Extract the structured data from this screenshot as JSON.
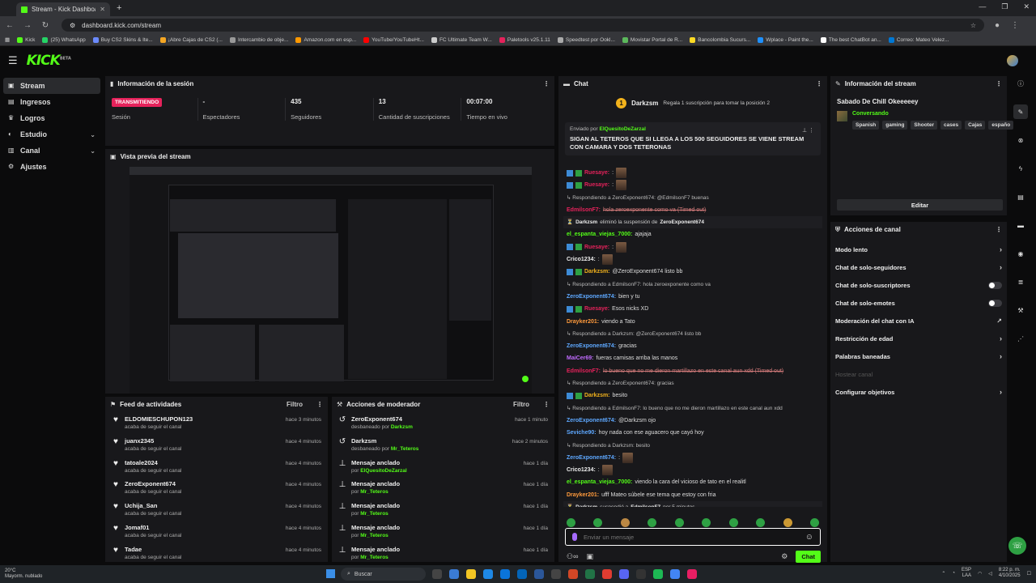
{
  "browser": {
    "tab_title": "Stream - Kick Dashboard",
    "url": "dashboard.kick.com/stream",
    "bookmarks": [
      "Kick",
      "(25) WhatsApp",
      "Buy CS2 Skins & Ite...",
      "¡Abre Cajas de CS2 (...",
      "Intercambio de obje...",
      "Amazon.com en esp...",
      "YouTube/YouTubeHt...",
      "FC Ultimate Team W...",
      "Paletools v25.1.11",
      "Speedtest por Ookl...",
      "Movistar Portal de R...",
      "Bancolombia Sucurs...",
      "Wplace - Paint the...",
      "The best ChatBot an...",
      "Correo: Mateo Velez..."
    ]
  },
  "sidebar": {
    "items": [
      {
        "label": "Stream",
        "icon": "stream-icon"
      },
      {
        "label": "Ingresos",
        "icon": "money-icon"
      },
      {
        "label": "Logros",
        "icon": "trophy-icon"
      },
      {
        "label": "Estudio",
        "icon": "studio-icon"
      },
      {
        "label": "Canal",
        "icon": "channel-icon"
      },
      {
        "label": "Ajustes",
        "icon": "gear-icon"
      }
    ]
  },
  "session": {
    "title": "Información de la sesión",
    "live_badge": "TRANSMITIENDO",
    "stats": [
      {
        "value": "",
        "label": "Sesión"
      },
      {
        "value": "-",
        "label": "Espectadores"
      },
      {
        "value": "435",
        "label": "Seguidores"
      },
      {
        "value": "13",
        "label": "Cantidad de suscripciones"
      },
      {
        "value": "00:07:00",
        "label": "Tiempo en vivo"
      }
    ]
  },
  "preview": {
    "title": "Vista previa del stream"
  },
  "activity": {
    "title": "Feed de actividades",
    "filter": "Filtro",
    "rows": [
      {
        "name": "ELDOMIESCHUPON123",
        "sub": "acaba de seguir el canal",
        "time": "hace 3 minutos"
      },
      {
        "name": "juanx2345",
        "sub": "acaba de seguir el canal",
        "time": "hace 4 minutos"
      },
      {
        "name": "tatoale2024",
        "sub": "acaba de seguir el canal",
        "time": "hace 4 minutos"
      },
      {
        "name": "ZeroExponent674",
        "sub": "acaba de seguir el canal",
        "time": "hace 4 minutos"
      },
      {
        "name": "Uchija_San",
        "sub": "acaba de seguir el canal",
        "time": "hace 4 minutos"
      },
      {
        "name": "Jomaf01",
        "sub": "acaba de seguir el canal",
        "time": "hace 4 minutos"
      },
      {
        "name": "Tadae",
        "sub": "acaba de seguir el canal",
        "time": "hace 4 minutos"
      }
    ]
  },
  "moderator": {
    "title": "Acciones de moderador",
    "filter": "Filtro",
    "rows": [
      {
        "name": "ZeroExponent674",
        "sub": "desbaneado por",
        "by": "Darkzsm",
        "time": "hace 1 minuto"
      },
      {
        "name": "Darkzsm",
        "sub": "desbaneado por",
        "by": "Mr_Teteros",
        "time": "hace 2 minutos"
      },
      {
        "name": "Mensaje anclado",
        "sub": "por",
        "by": "ElQuesitoDeZarzal",
        "time": "hace 1 día"
      },
      {
        "name": "Mensaje anclado",
        "sub": "por",
        "by": "Mr_Teteros",
        "time": "hace 1 día"
      },
      {
        "name": "Mensaje anclado",
        "sub": "por",
        "by": "Mr_Teteros",
        "time": "hace 1 día"
      },
      {
        "name": "Mensaje anclado",
        "sub": "por",
        "by": "Mr_Teteros",
        "time": "hace 1 día"
      },
      {
        "name": "Mensaje anclado",
        "sub": "por",
        "by": "Mr_Teteros",
        "time": "hace 1 día"
      }
    ]
  },
  "chat": {
    "title": "Chat",
    "gift_user": "Darkzsm",
    "gift_rank": "1",
    "gift_text": "Regala 1 suscripción para tomar la posición 2",
    "pinned_prefix": "Enviado por",
    "pinned_by": "ElQuesitoDeZarzal",
    "pinned_text": "SIGAN AL TETEROS QUE SI LLEGA A LOS 500 SEGUIDORES SE VIENE STREAM CON CAMARA Y DOS TETERONAS",
    "lines": [
      {
        "type": "emote",
        "user": "Ruesaye",
        "color": "#e5225b",
        "text": ":"
      },
      {
        "type": "emote",
        "user": "Ruesaye",
        "color": "#e5225b",
        "text": ":"
      },
      {
        "type": "sys",
        "text": "↳ Respondiendo a ZeroExponent674: @EdmilsonF7 buenas"
      },
      {
        "type": "strike",
        "user": "EdmilsonF7",
        "color": "#e5225b",
        "text": "hola zeroexponente como va (Timed out)"
      },
      {
        "type": "box",
        "user": "Darkzsm",
        "text": "eliminó la suspensión de",
        "target": "ZeroExponent674"
      },
      {
        "type": "msg",
        "user": "el_espanta_viejas_7000",
        "color": "#53fc18",
        "text": "ajajaja"
      },
      {
        "type": "emote",
        "user": "Ruesaye",
        "color": "#e5225b",
        "text": ":"
      },
      {
        "type": "msg",
        "user": "Crico1234",
        "color": "#eee",
        "text": ":"
      },
      {
        "type": "msg",
        "user": "Darkzsm",
        "color": "#f2b21c",
        "text": "@ZeroExponent674 listo bb"
      },
      {
        "type": "sys",
        "text": "↳ Respondiendo a EdmilsonF7: hola zeroexponente como va"
      },
      {
        "type": "msg",
        "user": "ZeroExponent674",
        "color": "#5ea8ff",
        "text": "bien y tu"
      },
      {
        "type": "msg",
        "user": "Ruesaye",
        "color": "#e5225b",
        "text": "Esos nicks XD"
      },
      {
        "type": "msg",
        "user": "Drayker201",
        "color": "#ff9a3c",
        "text": "viendo a Tato"
      },
      {
        "type": "sys",
        "text": "↳ Respondiendo a Darkzsm: @ZeroExponent674 listo bb"
      },
      {
        "type": "msg",
        "user": "ZeroExponent674",
        "color": "#5ea8ff",
        "text": "gracias"
      },
      {
        "type": "msg",
        "user": "MaiCer69",
        "color": "#c06bff",
        "text": "fueras camisas arriba las manos"
      },
      {
        "type": "strike",
        "user": "EdmilsonF7",
        "color": "#e5225b",
        "text": "lo bueno que no me dieron martillazo en este canal aun xdd (Timed out)"
      },
      {
        "type": "sys",
        "text": "↳ Respondiendo a ZeroExponent674: gracias"
      },
      {
        "type": "msg",
        "user": "Darkzsm",
        "color": "#f2b21c",
        "text": "besito"
      },
      {
        "type": "sys",
        "text": "↳ Respondiendo a EdmilsonF7: lo bueno que no me dieron martillazo en este canal aun xdd"
      },
      {
        "type": "msg",
        "user": "ZeroExponent674",
        "color": "#5ea8ff",
        "text": "@Darkzsm ojo"
      },
      {
        "type": "msg",
        "user": "Seviche90",
        "color": "#5ea8ff",
        "text": "hoy nada con ese aguacero que cayó hoy"
      },
      {
        "type": "sys",
        "text": "↳ Respondiendo a Darkzsm: besito"
      },
      {
        "type": "msg",
        "user": "ZeroExponent674",
        "color": "#5ea8ff",
        "text": ":"
      },
      {
        "type": "msg",
        "user": "Crico1234",
        "color": "#eee",
        "text": ":"
      },
      {
        "type": "msg",
        "user": "el_espanta_viejas_7000",
        "color": "#53fc18",
        "text": "viendo la cara del vicioso de tato en el realitl"
      },
      {
        "type": "msg",
        "user": "Drayker201",
        "color": "#ff9a3c",
        "text": "ufff Mateo súbele ese tema que estoy con fria"
      },
      {
        "type": "box",
        "user": "Darkzsm",
        "text": "suspendió a",
        "target": "EdmilsonF7",
        "extra": "por 5 minutos"
      },
      {
        "type": "emote",
        "user": "Ruesaye",
        "color": "#e5225b",
        "text": ":"
      },
      {
        "type": "emote",
        "user": "Ruesaye",
        "color": "#e5225b",
        "text": ":"
      }
    ],
    "input_placeholder": "Enviar un mensaje",
    "send_label": "Chat"
  },
  "stream_info": {
    "title": "Información del stream",
    "stream_title": "Sabado De Chill Okeeeeey",
    "category": "Conversando",
    "tags": [
      "Spanish",
      "gaming",
      "Shooter",
      "cases",
      "Cajas",
      "españo"
    ],
    "edit_label": "Editar"
  },
  "channel_actions": {
    "title": "Acciones de canal",
    "items": [
      {
        "label": "Modo lento",
        "control": "chevron"
      },
      {
        "label": "Chat de solo-seguidores",
        "control": "chevron"
      },
      {
        "label": "Chat de solo-suscriptores",
        "control": "toggle"
      },
      {
        "label": "Chat de solo-emotes",
        "control": "toggle"
      },
      {
        "label": "Moderación del chat con IA",
        "control": "external"
      },
      {
        "label": "Restricción de edad",
        "control": "chevron"
      },
      {
        "label": "Palabras baneadas",
        "control": "chevron"
      },
      {
        "label": "Hostear canal",
        "control": "disabled"
      },
      {
        "label": "Configurar objetivos",
        "control": "chevron"
      }
    ]
  },
  "taskbar": {
    "weather_temp": "20°C",
    "weather_desc": "Mayorm. nublado",
    "search": "Buscar",
    "lang1": "ESP",
    "lang2": "LAA",
    "time": "8:22 p. m.",
    "date": "4/10/2025"
  },
  "colors": {
    "kick_green": "#53fc18",
    "live_red": "#e5225b",
    "panel": "#18181b",
    "bg": "#0b0b0c"
  }
}
